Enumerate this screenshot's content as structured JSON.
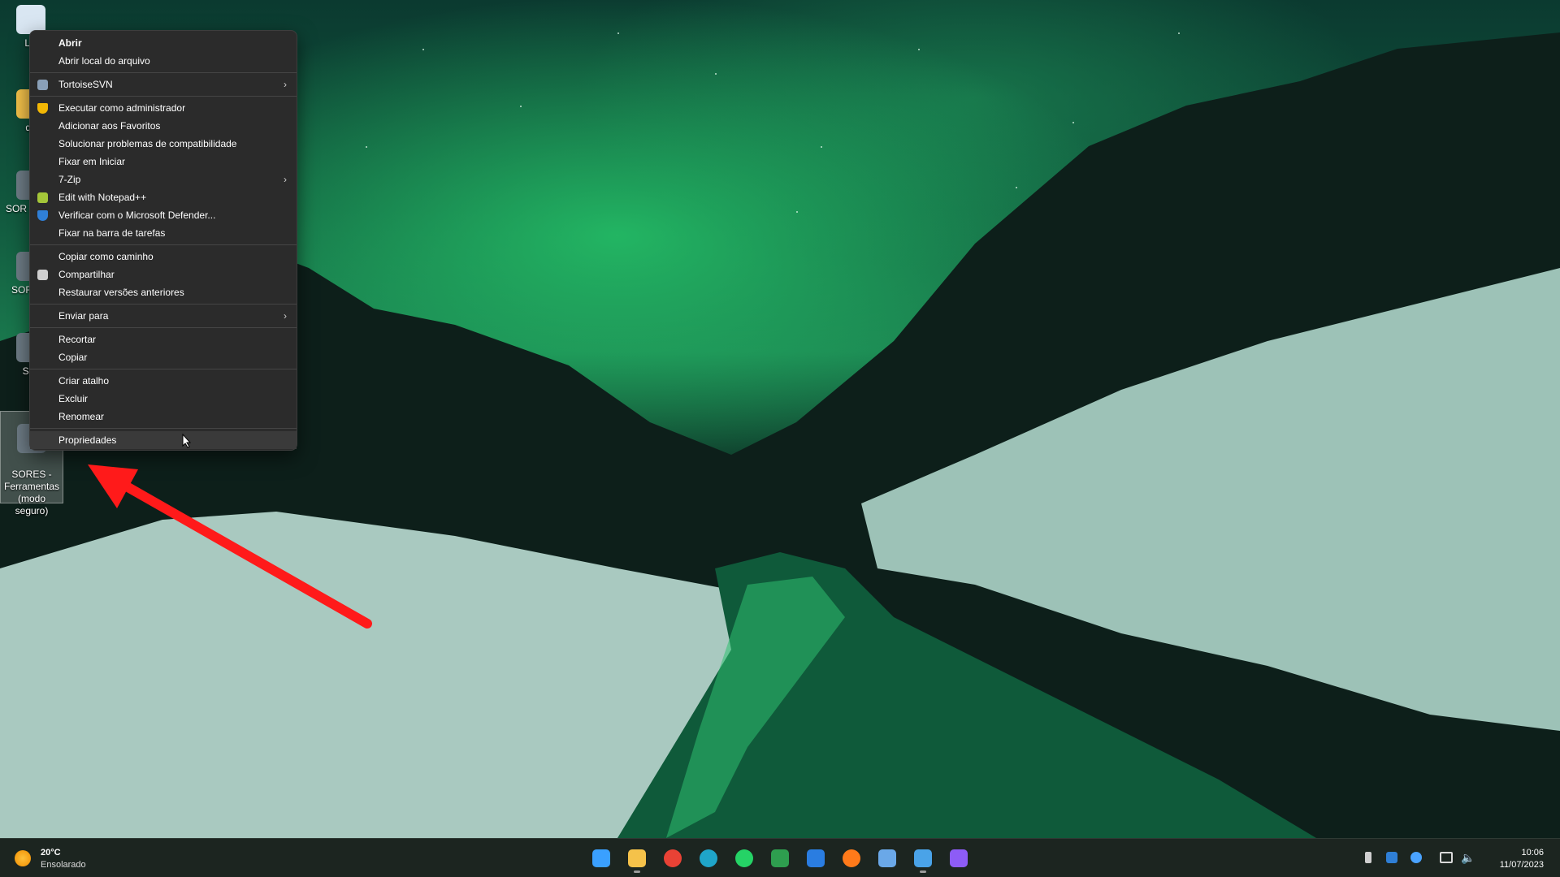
{
  "desktop": {
    "icons": [
      {
        "label": "Lix"
      },
      {
        "label": "da"
      },
      {
        "label": "SOR\nFerrar"
      },
      {
        "label": "SOR\nPor"
      },
      {
        "label": "SOI"
      },
      {
        "label": "SORES -\nFerramentas\n(modo\nseguro)"
      }
    ]
  },
  "context_menu": {
    "items": [
      {
        "label": "Abrir",
        "bold": true
      },
      {
        "label": "Abrir local do arquivo"
      },
      {
        "sep": true
      },
      {
        "label": "TortoiseSVN",
        "submenu": true,
        "icon": "tortoisesvn-icon"
      },
      {
        "sep": true
      },
      {
        "label": "Executar como administrador",
        "icon": "uac-shield-icon"
      },
      {
        "label": "Adicionar aos Favoritos"
      },
      {
        "label": "Solucionar problemas de compatibilidade"
      },
      {
        "label": "Fixar em Iniciar"
      },
      {
        "label": "7-Zip",
        "submenu": true
      },
      {
        "label": "Edit with Notepad++",
        "icon": "notepadpp-icon"
      },
      {
        "label": "Verificar com o Microsoft Defender...",
        "icon": "defender-shield-icon"
      },
      {
        "label": "Fixar na barra de tarefas"
      },
      {
        "sep": true
      },
      {
        "label": "Copiar como caminho"
      },
      {
        "label": "Compartilhar",
        "icon": "share-icon"
      },
      {
        "label": "Restaurar versões anteriores"
      },
      {
        "sep": true
      },
      {
        "label": "Enviar para",
        "submenu": true
      },
      {
        "sep": true
      },
      {
        "label": "Recortar"
      },
      {
        "label": "Copiar"
      },
      {
        "sep": true
      },
      {
        "label": "Criar atalho"
      },
      {
        "label": "Excluir"
      },
      {
        "label": "Renomear"
      },
      {
        "sep": true
      },
      {
        "label": "Propriedades",
        "hover": true
      }
    ],
    "submenu_arrow": "›"
  },
  "taskbar": {
    "weather": {
      "temp": "20°C",
      "condition": "Ensolarado"
    },
    "pinned": [
      "windows-start-icon",
      "file-explorer-icon",
      "chrome-icon",
      "edge-icon",
      "whatsapp-icon",
      "spreadsheet-app-icon",
      "remote-app-icon",
      "firefox-icon",
      "settings-gear-icon",
      "notepad-icon",
      "clipchamp-icon"
    ],
    "clock": {
      "time": "10:06",
      "date": "11/07/2023"
    }
  },
  "colors": {
    "menu_bg": "#2b2b2b",
    "annotation_arrow": "#ff1a1a",
    "taskbar_bg": "#1c2520"
  }
}
